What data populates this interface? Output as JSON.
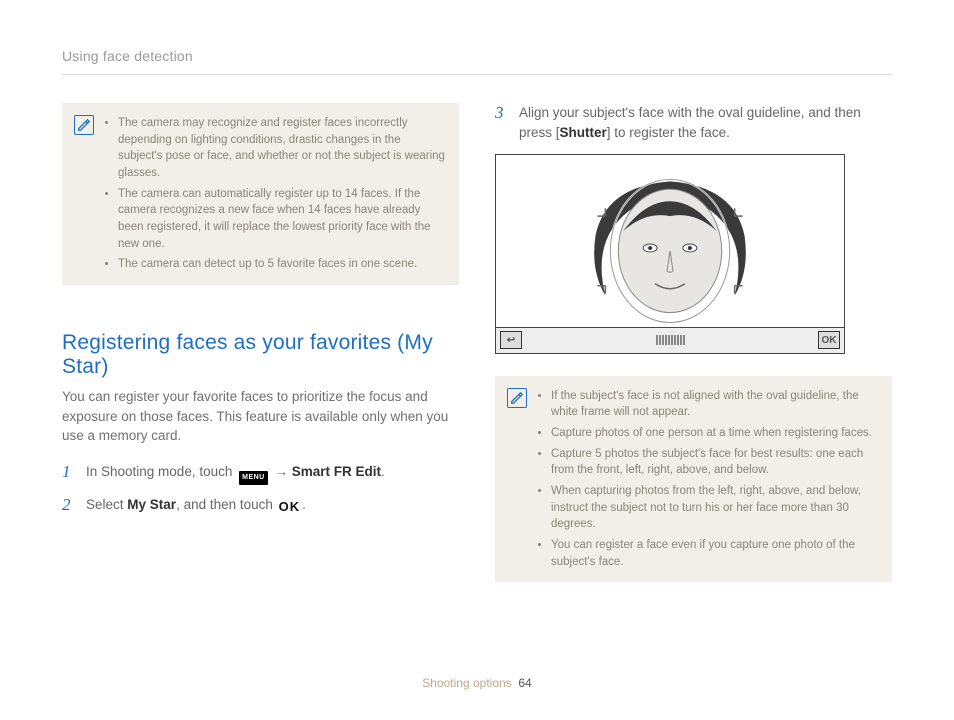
{
  "header": {
    "breadcrumb": "Using face detection"
  },
  "left": {
    "note": {
      "items": [
        "The camera may recognize and register faces incorrectly depending on lighting conditions, drastic changes in the subject's pose or face, and whether or not the subject is wearing glasses.",
        "The camera can automatically register up to 14 faces. If the camera recognizes a new face when 14 faces have already been registered, it will replace the lowest priority face with the new one.",
        "The camera can detect up to 5 favorite faces in one scene."
      ]
    },
    "heading": "Registering faces as your favorites (My Star)",
    "intro": "You can register your favorite faces to prioritize the focus and exposure on those faces. This feature is available only when you use a memory card.",
    "step1": {
      "pre": "In Shooting mode, touch ",
      "menu": "MENU",
      "arrow": " → ",
      "bold": "Smart FR Edit",
      "post": "."
    },
    "step2": {
      "pre": "Select ",
      "bold1": "My Star",
      "mid": ", and then touch ",
      "ok": "OK",
      "post": "."
    }
  },
  "right": {
    "step3": {
      "pre": "Align your subject's face with the oval guideline, and then press [",
      "bold": "Shutter",
      "post": "] to register the face."
    },
    "figure": {
      "back_label": "↩",
      "ok_label": "OK"
    },
    "note": {
      "items": [
        "If the subject's face is not aligned with the oval guideline, the white frame will not appear.",
        "Capture photos of one person at a time when registering faces.",
        "Capture 5 photos the subject's face for best results: one each from the front, left, right, above, and below.",
        "When capturing photos from the left, right, above, and below, instruct the subject not to turn his or her face more than 30 degrees.",
        "You can register a face even if you capture one photo of the subject's face."
      ]
    }
  },
  "footer": {
    "section": "Shooting options",
    "page": "64"
  }
}
